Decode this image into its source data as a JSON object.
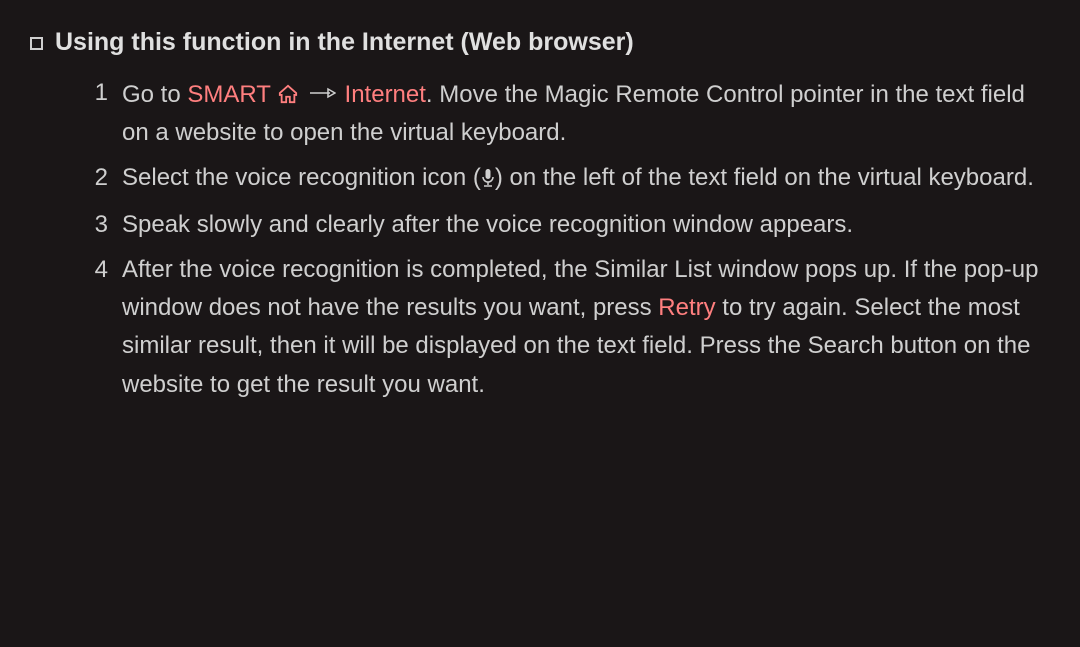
{
  "heading": "Using this function in the Internet (Web browser)",
  "steps": [
    {
      "num": "1",
      "pre": "Go to ",
      "smart": "SMART",
      "internet": "Internet",
      "post": ". Move the Magic Remote Control pointer in the text field on a website to open the virtual keyboard."
    },
    {
      "num": "2",
      "pre": "Select the voice recognition icon (",
      "post": ") on the left of the text field on the virtual keyboard."
    },
    {
      "num": "3",
      "text": "Speak slowly and clearly after the voice recognition window appears."
    },
    {
      "num": "4",
      "pre": "After the voice recognition is completed, the Similar List window pops up. If the pop-up window does not have the results you want, press ",
      "retry": "Retry",
      "post": " to try again. Select the most similar result, then it will be displayed on the text field. Press the Search button on the website to get the result you want."
    }
  ]
}
